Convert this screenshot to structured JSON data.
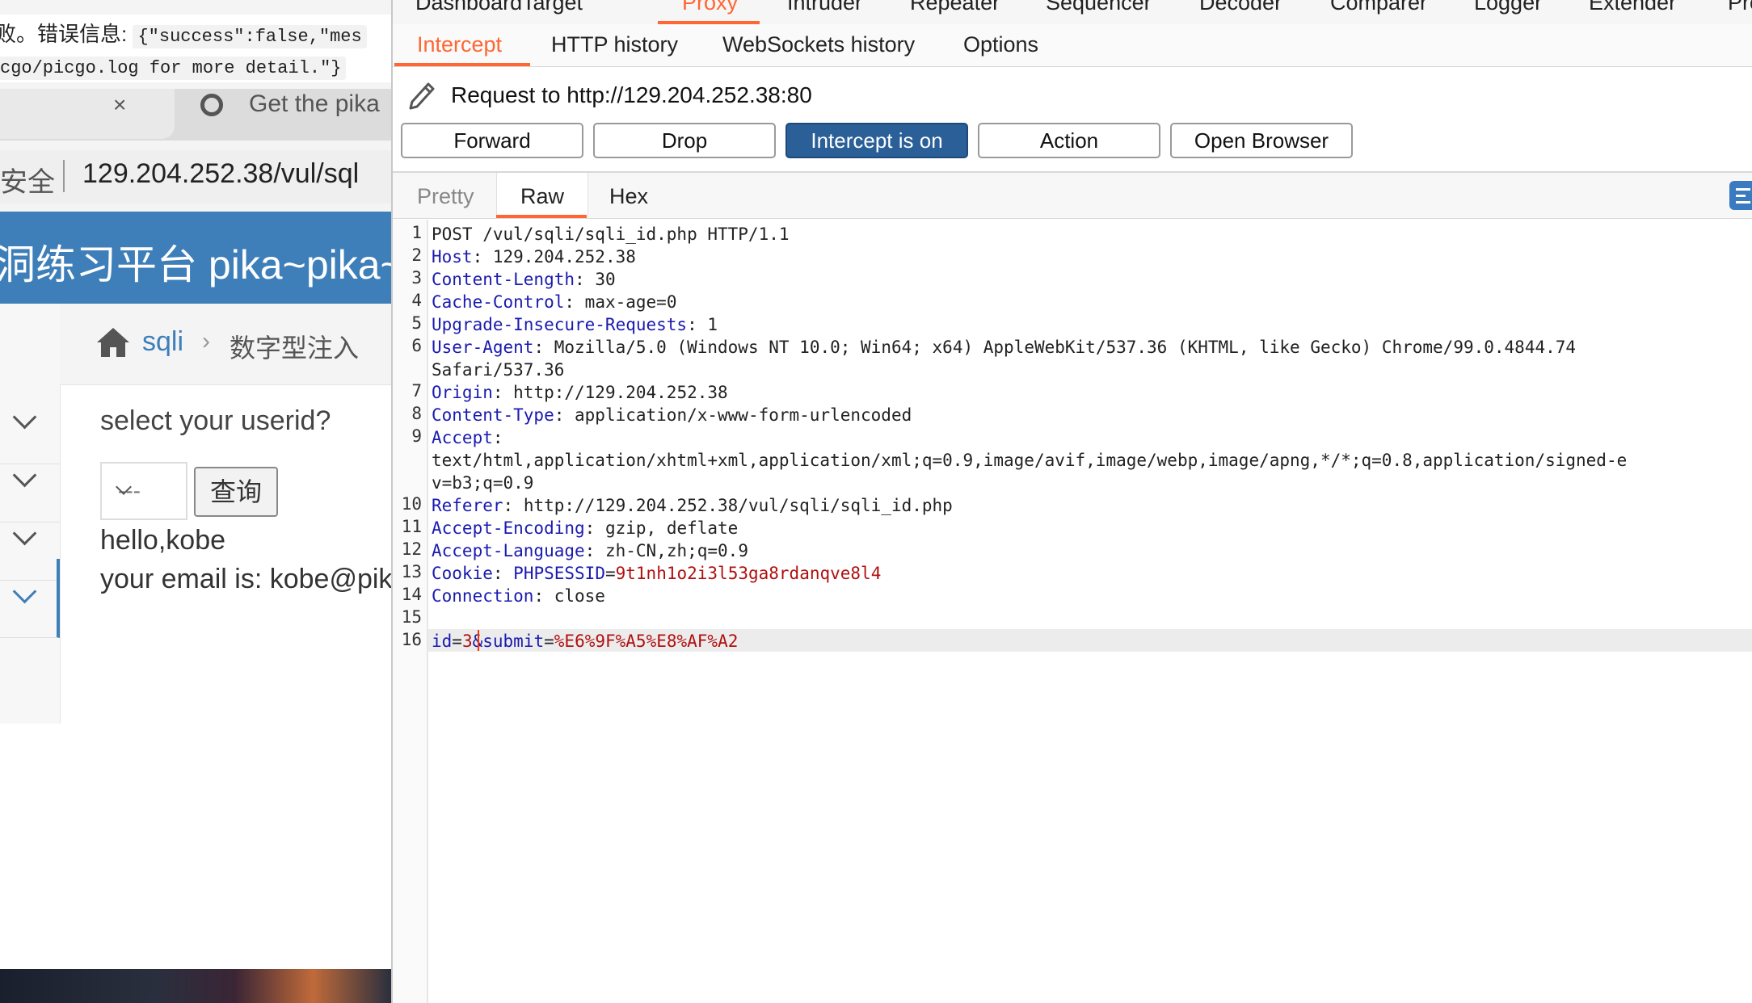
{
  "browser": {
    "notice": {
      "line1_text": "败。错误信息:",
      "line1_code": "{\"success\":false,\"mes",
      "line2_code": "cgo/picgo.log for more detail.\"}"
    },
    "tab_close": "×",
    "tab2_label": "Get the pika",
    "address": {
      "security": "安全",
      "url": "129.204.252.38/vul/sql"
    },
    "site_title": "洞练习平台 pika~pika~",
    "breadcrumb": {
      "link": "sqli",
      "separator": "›",
      "current": "数字型注入"
    },
    "form": {
      "question": "select your userid?",
      "select_value": "---",
      "query_button": "查询"
    },
    "result": {
      "hello": "hello,kobe",
      "email": "your email is: kobe@pik"
    }
  },
  "burp": {
    "main_tabs": [
      "Dashboard",
      "Target",
      "Proxy",
      "Intruder",
      "Repeater",
      "Sequencer",
      "Decoder",
      "Comparer",
      "Logger",
      "Extender",
      "Pro"
    ],
    "sub_tabs": [
      "Intercept",
      "HTTP history",
      "WebSockets history",
      "Options"
    ],
    "request_label": "Request to http://129.204.252.38:80",
    "buttons": [
      "Forward",
      "Drop",
      "Intercept is on",
      "Action",
      "Open Browser"
    ],
    "view_tabs": [
      "Pretty",
      "Raw",
      "Hex"
    ],
    "request": {
      "line_numbers": [
        "1",
        "2",
        "3",
        "4",
        "5",
        "6",
        "7",
        "8",
        "9",
        "10",
        "11",
        "12",
        "13",
        "14",
        "15",
        "16"
      ],
      "request_line": "POST /vul/sqli/sqli_id.php HTTP/1.1",
      "headers": [
        {
          "name": "Host",
          "value": " 129.204.252.38"
        },
        {
          "name": "Content-Length",
          "value": " 30"
        },
        {
          "name": "Cache-Control",
          "value": " max-age=0"
        },
        {
          "name": "Upgrade-Insecure-Requests",
          "value": " 1"
        },
        {
          "name": "User-Agent",
          "value": " Mozilla/5.0 (Windows NT 10.0; Win64; x64) AppleWebKit/537.36 (KHTML, like Gecko) Chrome/99.0.4844.74"
        },
        {
          "name": "Origin",
          "value": " http://129.204.252.38"
        },
        {
          "name": "Content-Type",
          "value": " application/x-www-form-urlencoded"
        },
        {
          "name": "Accept",
          "value": ""
        },
        {
          "name": "Referer",
          "value": " http://129.204.252.38/vul/sqli/sqli_id.php"
        },
        {
          "name": "Accept-Encoding",
          "value": " gzip, deflate"
        },
        {
          "name": "Accept-Language",
          "value": " zh-CN,zh;q=0.9"
        },
        {
          "name": "Cookie",
          "value": " "
        },
        {
          "name": "Connection",
          "value": " close"
        }
      ],
      "user_agent_wrap": "Safari/537.36",
      "accept_value_1": "text/html,application/xhtml+xml,application/xml;q=0.9,image/avif,image/webp,image/apng,*/*;q=0.8,application/signed-e",
      "accept_value_2": "v=b3;q=0.9",
      "cookie_name": "PHPSESSID",
      "cookie_value": "9t1nh1o2i3l53ga8rdanqve8l4",
      "body_param1_name": "id",
      "body_param1_value": "3",
      "body_param2_name": "&submit",
      "body_param2_value": "%E6%9F%A5%E8%AF%A2",
      "equals": "=",
      "colon": ":"
    }
  }
}
